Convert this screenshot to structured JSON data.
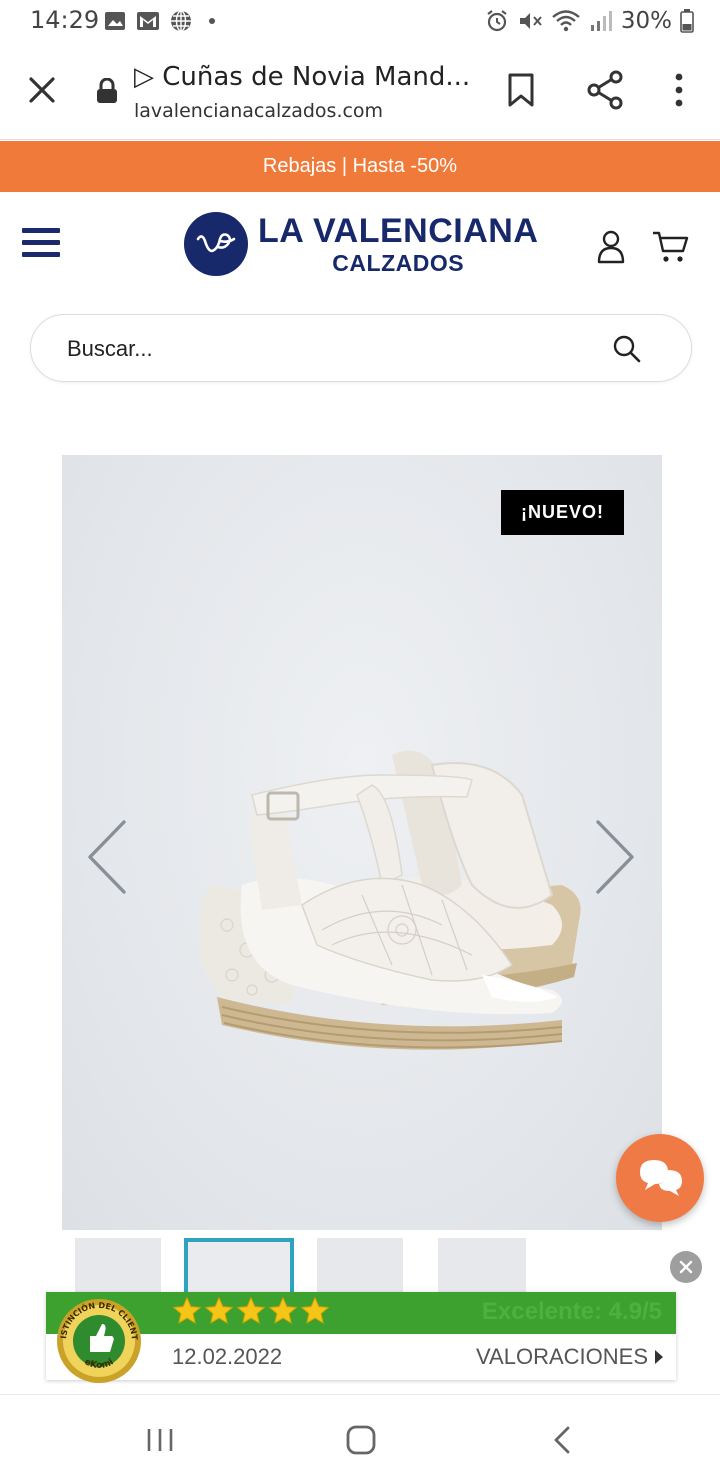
{
  "status_bar": {
    "time": "14:29",
    "battery": "30%",
    "icons": [
      "image-icon",
      "gmail-icon",
      "globe-icon",
      "dot-icon",
      "alarm-icon",
      "mute-icon",
      "wifi-icon",
      "signal-icon",
      "battery-icon"
    ]
  },
  "browser": {
    "title": "▷ Cuñas de Novia Mand...",
    "url": "lavalencianacalzados.com",
    "icons": [
      "close-icon",
      "lock-icon",
      "bookmark-icon",
      "share-icon",
      "more-icon"
    ]
  },
  "promo": {
    "text": "Rebajas | Hasta -50%",
    "color": "#f07a3a"
  },
  "header": {
    "logo_main": "LA VALENCIANA",
    "logo_sub": "CALZADOS",
    "brand_color": "#17286b"
  },
  "search": {
    "placeholder": "Buscar..."
  },
  "product": {
    "badge": "¡NUEVO!",
    "thumbnails_count": 4,
    "selected_thumbnail": 2
  },
  "ekomi": {
    "seal_text": "DISTINCIÓN DEL CLIENTE",
    "seal_brand": "eKomi",
    "stars": 5,
    "rating_text": "Excelente: 4.9/5",
    "date": "12.02.2022",
    "reviews_label": "VALORACIONES"
  },
  "colors": {
    "accent": "#f07a3a",
    "chat": "#f07a45",
    "ekomi_green": "#3da130",
    "thumb_selected": "#2ea3bd"
  }
}
